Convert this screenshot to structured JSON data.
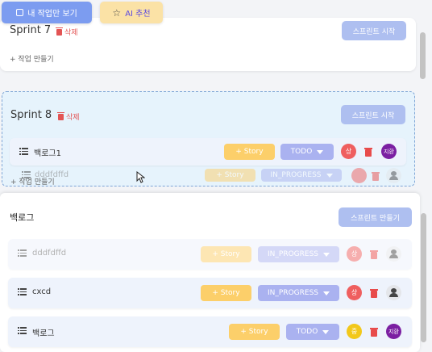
{
  "topbar": {
    "my_tasks_label": "내 작업만 보기",
    "ai_label": "AI 추천"
  },
  "sprint7": {
    "title": "Sprint 7",
    "delete_label": "삭제",
    "start_label": "스프린트 시작",
    "add_task_label": "+ 작업 만들기"
  },
  "sprint8": {
    "title": "Sprint 8",
    "delete_label": "삭제",
    "start_label": "스프린트 시작",
    "add_task_label": "+ 작업 만들기",
    "rows": [
      {
        "title": "백로그1",
        "story": "+ Story",
        "status": "TODO",
        "priority": "상",
        "assignee": "지환"
      }
    ],
    "dragging_row": {
      "title": "dddfdffd",
      "story": "+ Story",
      "status": "IN_PROGRESS"
    }
  },
  "backlog": {
    "title": "백로그",
    "make_sprint_label": "스프린트 만들기",
    "rows": [
      {
        "title": "dddfdffd",
        "story": "+ Story",
        "status": "IN_PROGRESS",
        "priority": "상"
      },
      {
        "title": "cxcd",
        "story": "+ Story",
        "status": "IN_PROGRESS",
        "priority": "상"
      },
      {
        "title": "백로그",
        "story": "+ Story",
        "status": "TODO",
        "priority": "중",
        "assignee": "지환"
      }
    ]
  },
  "colors": {
    "primary_button": "#aebff0",
    "story": "#fccf6a",
    "status": "#aab2f0",
    "priority_high": "#ef5f5f",
    "priority_mid": "#f2c81b",
    "assignee": "#7b1fa2",
    "delete": "#e35454"
  },
  "icons": [
    "checkbox-icon",
    "star-icon",
    "trash-icon",
    "list-icon",
    "chevron-down-icon",
    "person-icon",
    "move-cursor-icon"
  ]
}
